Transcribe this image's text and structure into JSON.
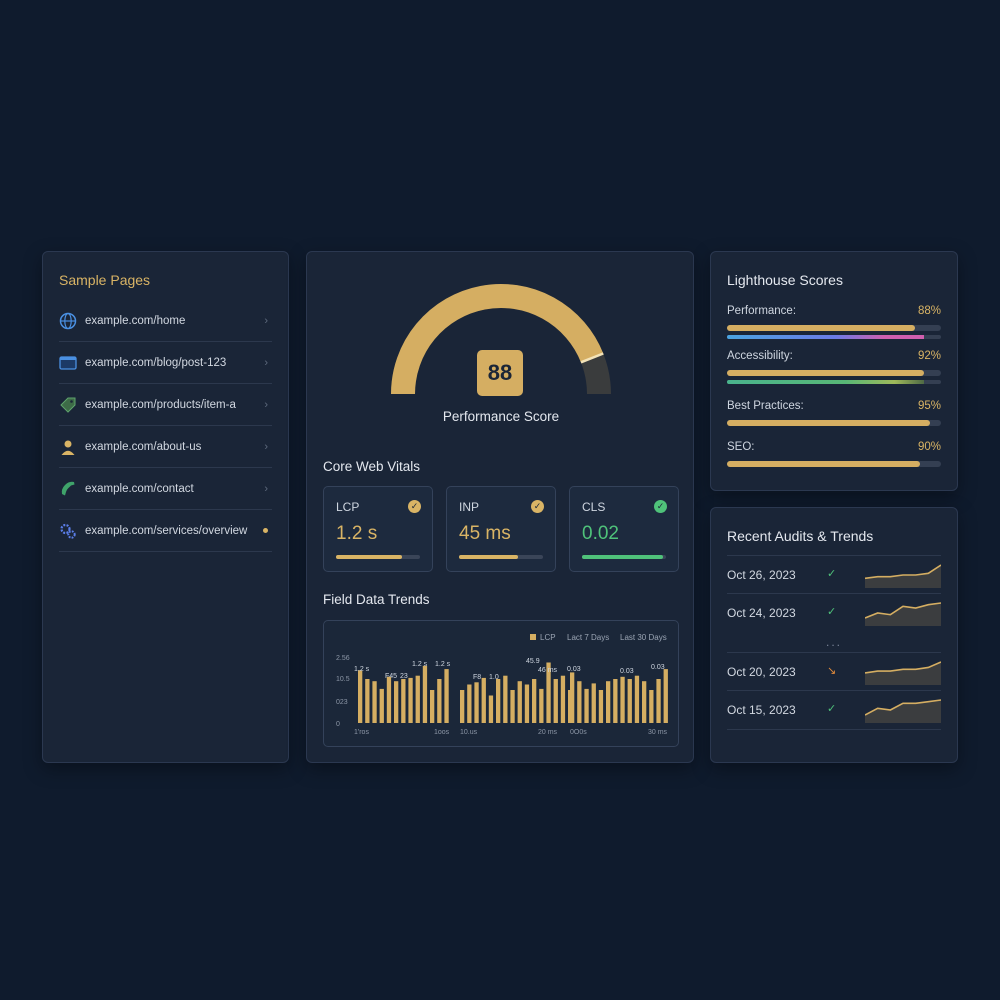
{
  "sample_pages": {
    "title": "Sample Pages",
    "items": [
      {
        "label": "example.com/home",
        "icon": "globe-icon",
        "marker": "chevron"
      },
      {
        "label": "example.com/blog/post-123",
        "icon": "browser-window-icon",
        "marker": "chevron"
      },
      {
        "label": "example.com/products/item-a",
        "icon": "tag-icon",
        "marker": "chevron"
      },
      {
        "label": "example.com/about-us",
        "icon": "person-icon",
        "marker": "chevron"
      },
      {
        "label": "example.com/contact",
        "icon": "phone-icon",
        "marker": "chevron"
      },
      {
        "label": "example.com/services/overview",
        "icon": "gears-icon",
        "marker": "dot"
      }
    ]
  },
  "performance": {
    "score": "88",
    "score_fraction": 0.88,
    "label": "Performance Score"
  },
  "core_web_vitals": {
    "title": "Core Web Vitals",
    "metrics": [
      {
        "name": "LCP",
        "value": "1.2 s",
        "color": "#d9b465",
        "fill": 0.78,
        "status_icon": "check-circle-icon"
      },
      {
        "name": "INP",
        "value": "45 ms",
        "color": "#d9b465",
        "fill": 0.7,
        "status_icon": "check-circle-icon"
      },
      {
        "name": "CLS",
        "value": "0.02",
        "color": "#4fc27a",
        "fill": 0.96,
        "status_icon": "check-circle-icon"
      }
    ]
  },
  "field_data": {
    "title": "Field Data Trends",
    "legend": {
      "series": "LCP",
      "range_a": "Lact 7 Days",
      "range_b": "Last 30 Days"
    },
    "yticks": [
      "2.56",
      "10.5",
      "023",
      "0"
    ],
    "xticks": [
      "1'ros",
      "1oos",
      "10.us",
      "20 ms",
      "0O0s",
      "30 ms"
    ],
    "annotations": [
      "1.2 s",
      "F45",
      "23",
      "1.2 s",
      "1.2 s",
      "F8",
      "1.0",
      "45.9",
      "46 ms",
      "0.03",
      "0.03",
      "0.03"
    ]
  },
  "chart_data": {
    "type": "bar",
    "series": [
      {
        "name": "LCP",
        "values": [
          48,
          40,
          38,
          31,
          42,
          38,
          40,
          41,
          43,
          52,
          30,
          40,
          49
        ]
      },
      {
        "values": [
          30,
          35,
          37,
          41,
          25,
          40,
          43,
          30,
          38,
          35,
          40,
          31,
          55,
          40,
          43,
          30
        ]
      },
      {
        "values": [
          46,
          38,
          31,
          36,
          30,
          38,
          40,
          42,
          40,
          43,
          38,
          30,
          40,
          49
        ]
      }
    ],
    "colors": [
      "#d5ae62"
    ]
  },
  "lighthouse": {
    "title": "Lighthouse Scores",
    "rows": [
      {
        "name": "Performance:",
        "pct": "88%",
        "value": 0.88
      },
      {
        "name": "Accessibility:",
        "pct": "92%",
        "value": 0.92
      },
      {
        "name": "Best Practices:",
        "pct": "95%",
        "value": 0.95
      },
      {
        "name": "SEO:",
        "pct": "90%",
        "value": 0.9
      }
    ]
  },
  "audits": {
    "title": "Recent Audits & Trends",
    "ellipsis": "...",
    "rows": [
      {
        "date": "Oct 26, 2023",
        "status": "✓",
        "status_color": "#4fc27a",
        "trend": [
          4,
          5,
          5,
          6,
          6,
          7,
          12
        ]
      },
      {
        "date": "Oct 24, 2023",
        "status": "✓",
        "status_color": "#4fc27a",
        "trend": [
          3,
          6,
          5,
          10,
          9,
          11,
          12
        ]
      },
      {
        "date": "Oct 20, 2023",
        "status": "↘",
        "status_color": "#e08a3c",
        "trend": [
          5,
          6,
          6,
          7,
          7,
          8,
          11
        ]
      },
      {
        "date": "Oct 15, 2023",
        "status": "✓",
        "status_color": "#4fc27a",
        "trend": [
          3,
          7,
          6,
          10,
          10,
          11,
          12
        ]
      }
    ]
  }
}
